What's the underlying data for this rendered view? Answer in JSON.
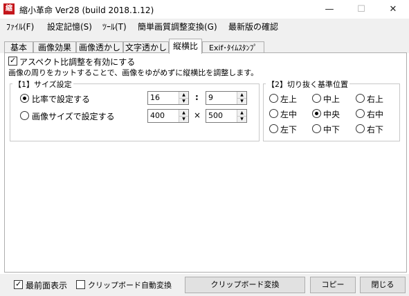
{
  "window": {
    "title": "縮小革命 Ver28 (build 2018.1.12)",
    "icon_text": "縮",
    "controls": {
      "minimize": "—",
      "maximize": "☐",
      "close": "✕"
    }
  },
  "menu": [
    "ﾌｧｲﾙ(F)",
    "設定記憶(S)",
    "ﾂｰﾙ(T)",
    "簡単画質調整変換(G)",
    "最新版の確認"
  ],
  "tabs": [
    {
      "label": "基本",
      "active": false
    },
    {
      "label": "画像効果",
      "active": false
    },
    {
      "label": "画像透かし",
      "active": false
    },
    {
      "label": "文字透かし",
      "active": false
    },
    {
      "label": "縦横比",
      "active": true
    },
    {
      "label": "Exif･ﾀｲﾑｽﾀﾝﾌﾟ",
      "active": false
    }
  ],
  "panel": {
    "enable_checkbox": {
      "label": "アスペクト比調整を有効にする",
      "checked": true
    },
    "description": "画像の周りをカットすることで、画像をゆがめずに縦横比を調整します。",
    "size_group": {
      "title": "【1】サイズ設定",
      "ratio_option": {
        "label": "比率で設定する",
        "selected": true,
        "value1": "16",
        "separator": ":",
        "value2": "9"
      },
      "size_option": {
        "label": "画像サイズで設定する",
        "selected": false,
        "value1": "400",
        "separator": "×",
        "value2": "500"
      }
    },
    "crop_group": {
      "title": "【2】切り抜く基準位置",
      "positions": [
        {
          "label": "左上",
          "selected": false
        },
        {
          "label": "中上",
          "selected": false
        },
        {
          "label": "右上",
          "selected": false
        },
        {
          "label": "左中",
          "selected": false
        },
        {
          "label": "中央",
          "selected": true
        },
        {
          "label": "右中",
          "selected": false
        },
        {
          "label": "左下",
          "selected": false
        },
        {
          "label": "中下",
          "selected": false
        },
        {
          "label": "右下",
          "selected": false
        }
      ]
    }
  },
  "bottom": {
    "topmost": {
      "label": "最前面表示",
      "checked": true
    },
    "clipboard_auto": {
      "label": "クリップボード自動変換",
      "checked": false
    },
    "clipboard_convert_button": "クリップボード変換",
    "copy_button": "コピー",
    "close_button": "閉じる"
  }
}
